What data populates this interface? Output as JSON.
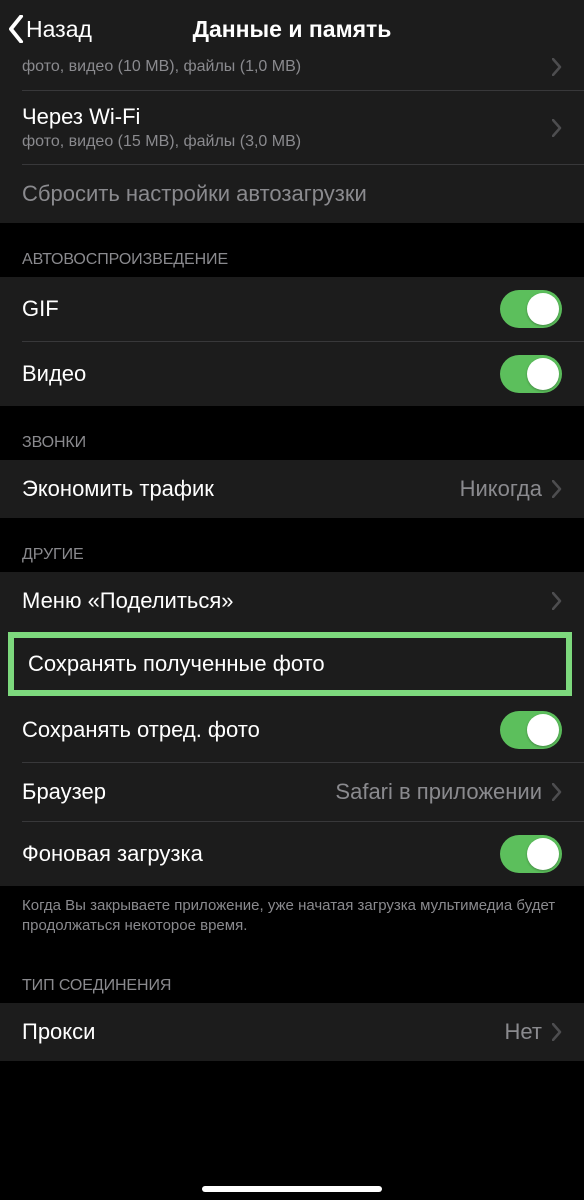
{
  "nav": {
    "back": "Назад",
    "title": "Данные и память"
  },
  "partial": {
    "sub": "фото, видео (10 MB), файлы (1,0 MB)"
  },
  "wifi": {
    "label": "Через Wi-Fi",
    "sub": "фото, видео (15 MB), файлы (3,0 MB)"
  },
  "reset": {
    "label": "Сбросить настройки автозагрузки"
  },
  "autoplay": {
    "header": "АВТОВОСПРОИЗВЕДЕНИЕ",
    "gif": "GIF",
    "video": "Видео"
  },
  "calls": {
    "header": "ЗВОНКИ",
    "save_traffic": "Экономить трафик",
    "value": "Никогда"
  },
  "other": {
    "header": "ДРУГИЕ",
    "share_menu": "Меню «Поделиться»",
    "save_incoming": "Сохранять полученные фото",
    "save_edited": "Сохранять отред. фото",
    "browser": "Браузер",
    "browser_value": "Safari в приложении",
    "background": "Фоновая загрузка",
    "footer": "Когда Вы закрываете приложение, уже начатая загрузка мультимедиа будет продолжаться некоторое время."
  },
  "connection": {
    "header": "ТИП СОЕДИНЕНИЯ",
    "proxy": "Прокси",
    "proxy_value": "Нет"
  }
}
